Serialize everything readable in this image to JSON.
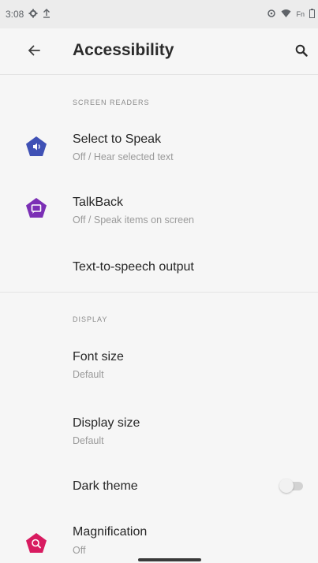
{
  "status_bar": {
    "time": "3:08",
    "icons_left": [
      "gear-icon",
      "upload-arrow-icon"
    ],
    "icons_right": [
      "sync-icon",
      "wifi-icon",
      "signal-icon",
      "battery-icon"
    ],
    "signal_text": "Fn"
  },
  "app_bar": {
    "title": "Accessibility",
    "back_icon": "arrow-back-icon",
    "search_icon": "search-icon"
  },
  "sections": {
    "screen_readers": {
      "header": "SCREEN READERS",
      "items": [
        {
          "title": "Select to Speak",
          "subtitle": "Off / Hear selected text",
          "icon": "select-to-speak-icon",
          "color": "#3f51b5"
        },
        {
          "title": "TalkBack",
          "subtitle": "Off / Speak items on screen",
          "icon": "talkback-icon",
          "color": "#7b2fb5"
        },
        {
          "title": "Text-to-speech output"
        }
      ]
    },
    "display": {
      "header": "DISPLAY",
      "items": [
        {
          "title": "Font size",
          "subtitle": "Default"
        },
        {
          "title": "Display size",
          "subtitle": "Default"
        },
        {
          "title": "Dark theme",
          "toggle": "off"
        },
        {
          "title": "Magnification",
          "subtitle": "Off",
          "icon": "magnification-icon",
          "color": "#d81b60"
        }
      ]
    }
  }
}
